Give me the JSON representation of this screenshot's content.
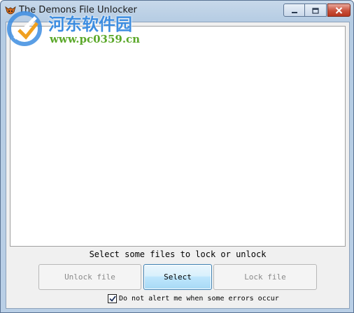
{
  "window": {
    "title": "The Demons File Unlocker"
  },
  "watermark": {
    "title": "河东软件园",
    "url": "www.pc0359.cn"
  },
  "status_text": "Select some files to lock or unlock",
  "buttons": {
    "unlock": "Unlock file",
    "select": "Select",
    "lock": "Lock file"
  },
  "option": {
    "label": "Do not alert me when some errors occur",
    "checked": true
  },
  "colors": {
    "titlebar": "#b9cfe6",
    "client_bg": "#f0f0f0",
    "watermark_blue": "#3d8de0",
    "watermark_green": "#5ba82a",
    "close_red": "#c9503a"
  }
}
